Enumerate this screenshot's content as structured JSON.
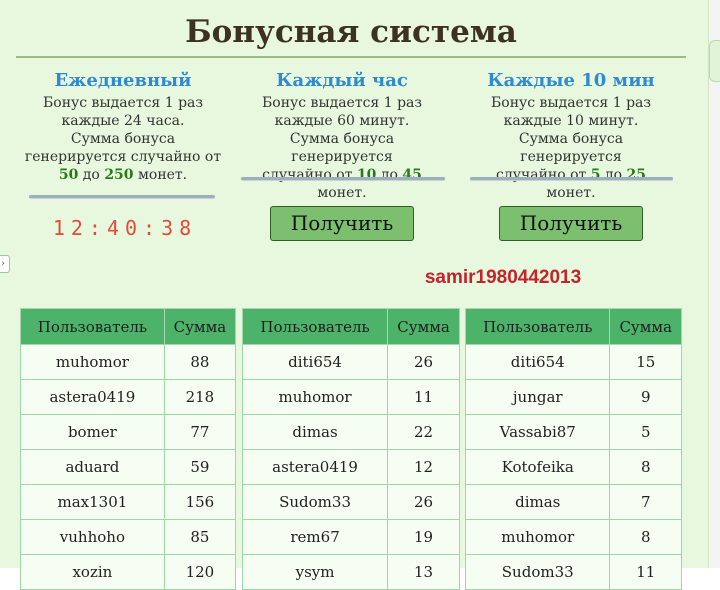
{
  "title": "Бонусная система",
  "columns": [
    {
      "heading": "Ежедневный",
      "line1": "Бонус выдается 1 раз",
      "line2": "каждые 24 часа.",
      "line3": "Сумма бонуса",
      "line4": "генерируется случайно от",
      "min": "50",
      "to": "до",
      "max": "250",
      "tail": "монет."
    },
    {
      "heading": "Каждый час",
      "line1": "Бонус выдается 1 раз",
      "line2": "каждые 60 минут.",
      "line3": "Сумма бонуса генерируется",
      "line4": "случайно от",
      "min": "10",
      "to": "до",
      "max": "45",
      "tail": "монет."
    },
    {
      "heading": "Каждые 10 мин",
      "line1": "Бонус выдается 1 раз",
      "line2": "каждые 10 минут.",
      "line3": "Сумма бонуса генерируется",
      "line4": "случайно от",
      "min": "5",
      "to": "до",
      "max": "25",
      "tail": "монет."
    }
  ],
  "timer": "12:40:38",
  "buttons": {
    "hourly": "Получить",
    "ten_min": "Получить"
  },
  "username": "samir1980442013",
  "tables": {
    "headers": {
      "user": "Пользователь",
      "sum": "Сумма"
    },
    "daily": [
      [
        "muhomor",
        "88"
      ],
      [
        "astera0419",
        "218"
      ],
      [
        "bomer",
        "77"
      ],
      [
        "aduard",
        "59"
      ],
      [
        "max1301",
        "156"
      ],
      [
        "vuhhoho",
        "85"
      ],
      [
        "xozin",
        "120"
      ]
    ],
    "hourly": [
      [
        "diti654",
        "26"
      ],
      [
        "muhomor",
        "11"
      ],
      [
        "dimas",
        "22"
      ],
      [
        "astera0419",
        "12"
      ],
      [
        "Sudom33",
        "26"
      ],
      [
        "rem67",
        "19"
      ],
      [
        "ysym",
        "13"
      ]
    ],
    "ten_min": [
      [
        "diti654",
        "15"
      ],
      [
        "jungar",
        "9"
      ],
      [
        "Vassabi87",
        "5"
      ],
      [
        "Kotofeika",
        "8"
      ],
      [
        "dimas",
        "7"
      ],
      [
        "muhomor",
        "8"
      ],
      [
        "Sudom33",
        "11"
      ]
    ]
  },
  "colors": {
    "panel_bg": "#e7f8df",
    "heading_blue": "#2f8ad0",
    "amount_green": "#2a7a1a",
    "timer_red": "#e24b3a",
    "button_green": "#7cbf6e",
    "username_red": "#c4232a",
    "table_header_green": "#4db36b"
  }
}
